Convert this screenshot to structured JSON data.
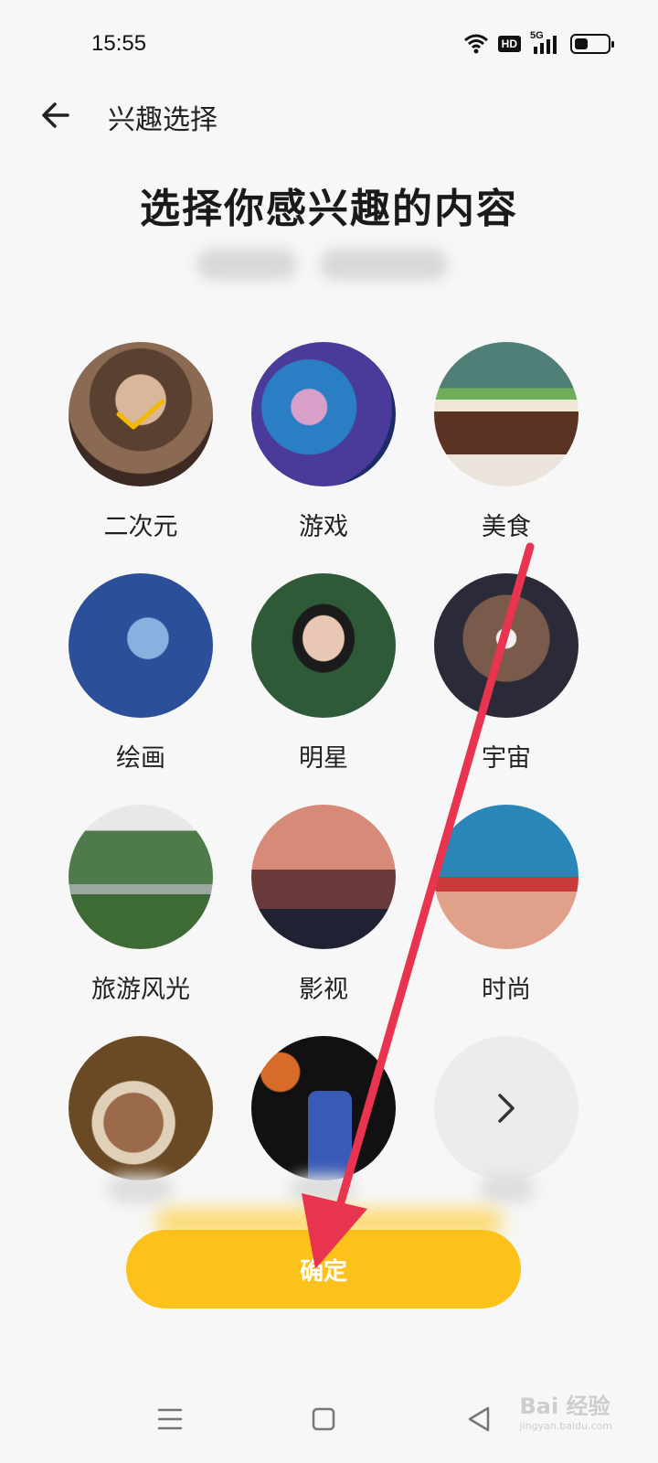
{
  "status": {
    "time": "15:55",
    "hd": "HD",
    "network": "5G"
  },
  "header": {
    "title": "兴趣选择"
  },
  "heading": "选择你感兴趣的内容",
  "interests": [
    {
      "label": "二次元",
      "selected": true
    },
    {
      "label": "游戏",
      "selected": false
    },
    {
      "label": "美食",
      "selected": false
    },
    {
      "label": "绘画",
      "selected": false
    },
    {
      "label": "明星",
      "selected": false
    },
    {
      "label": "宇宙",
      "selected": false
    },
    {
      "label": "旅游风光",
      "selected": false
    },
    {
      "label": "影视",
      "selected": false
    },
    {
      "label": "时尚",
      "selected": false
    },
    {
      "label": "",
      "selected": false
    },
    {
      "label": "",
      "selected": false
    }
  ],
  "confirm_label": "确定",
  "watermark": {
    "brand": "Bai 经验",
    "url": "jingyan.baidu.com"
  },
  "colors": {
    "accent": "#fcc21b",
    "check": "#f5b800",
    "annotation_arrow": "#e8344e"
  }
}
